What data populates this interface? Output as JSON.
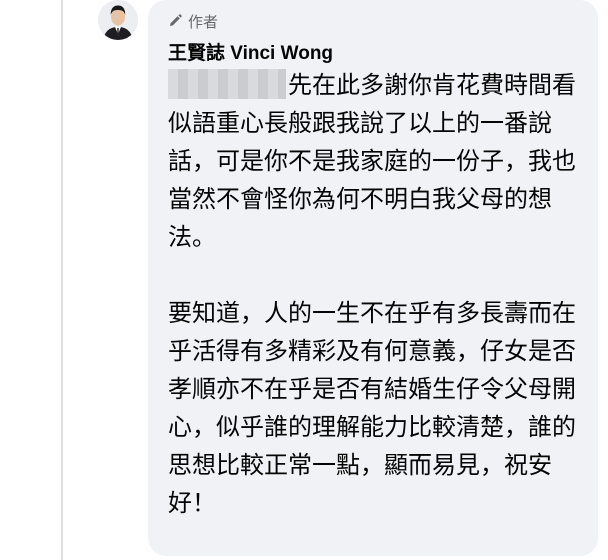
{
  "comment": {
    "author_badge": "作者",
    "author_name": "王賢誌 Vinci Wong",
    "paragraphs": [
      "先在此多謝你肯花費時間看似語重心長般跟我說了以上的一番說話，可是你不是我家庭的一份子，我也當然不會怪你為何不明白我父母的想法。",
      "要知道，人的一生不在乎有多長壽而在乎活得有多精彩及有何意義，仔女是否孝順亦不在乎是否有結婚生仔令父母開心，似乎誰的理解能力比較清楚，誰的思想比較正常一點，顯而易見，祝安好！"
    ]
  },
  "icons": {
    "badge_icon": "pencil-icon"
  },
  "colors": {
    "bubble_bg": "#f0f2f5",
    "text": "#050505",
    "secondary_text": "#65676b",
    "thread_line": "#dfe1e5"
  }
}
